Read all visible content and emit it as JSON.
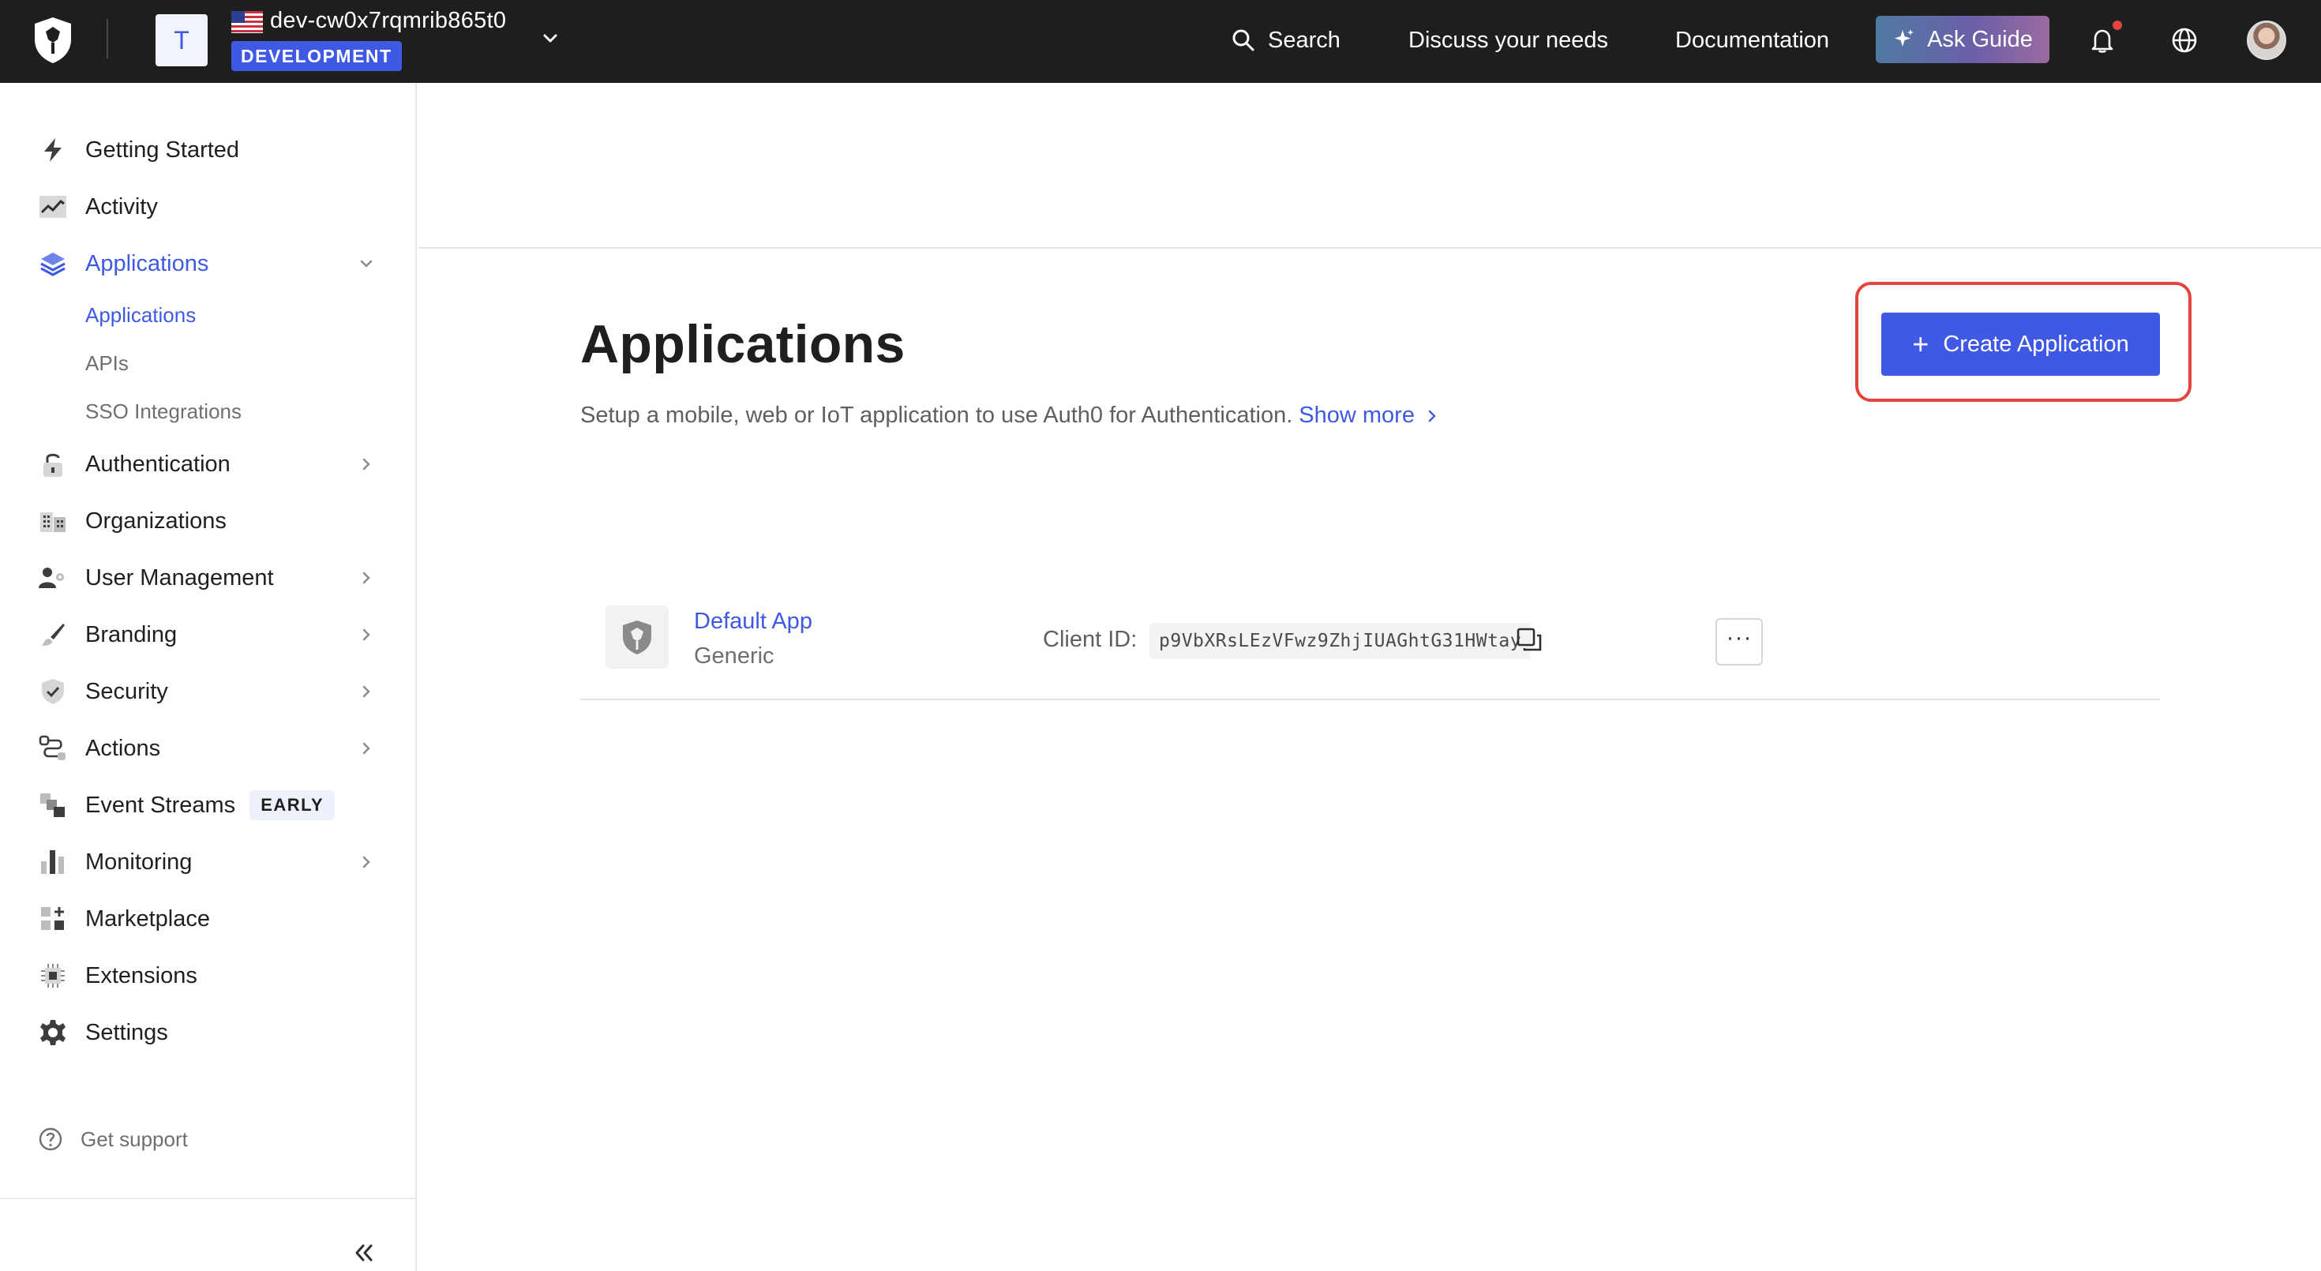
{
  "topbar": {
    "tenant_initial": "T",
    "tenant_name": "dev-cw0x7rqmrib865t0",
    "environment_badge": "DEVELOPMENT",
    "search_label": "Search",
    "discuss_label": "Discuss your needs",
    "documentation_label": "Documentation",
    "ask_guide_label": "Ask Guide",
    "icons": [
      "auth0-shield-logo",
      "us-flag-icon",
      "chevron-down-icon",
      "search-icon",
      "sparkle-icon",
      "bell-icon",
      "globe-icon",
      "user-avatar"
    ]
  },
  "sidebar": {
    "items": [
      {
        "label": "Getting Started",
        "icon": "lightning-icon"
      },
      {
        "label": "Activity",
        "icon": "activity-chart-icon"
      },
      {
        "label": "Applications",
        "icon": "layers-icon",
        "active": true,
        "expanded": true
      },
      {
        "label": "Authentication",
        "icon": "lock-icon"
      },
      {
        "label": "Organizations",
        "icon": "buildings-icon"
      },
      {
        "label": "User Management",
        "icon": "users-icon"
      },
      {
        "label": "Branding",
        "icon": "brush-icon"
      },
      {
        "label": "Security",
        "icon": "shield-check-icon"
      },
      {
        "label": "Actions",
        "icon": "flow-icon"
      },
      {
        "label": "Event Streams",
        "icon": "event-streams-icon",
        "badge": "EARLY"
      },
      {
        "label": "Monitoring",
        "icon": "bar-chart-icon"
      },
      {
        "label": "Marketplace",
        "icon": "marketplace-icon"
      },
      {
        "label": "Extensions",
        "icon": "chip-icon"
      },
      {
        "label": "Settings",
        "icon": "gear-icon"
      }
    ],
    "sub_items": [
      {
        "label": "Applications",
        "active": true
      },
      {
        "label": "APIs"
      },
      {
        "label": "SSO Integrations"
      }
    ],
    "support_label": "Get support"
  },
  "main": {
    "title": "Applications",
    "description": "Setup a mobile, web or IoT application to use Auth0 for Authentication.",
    "show_more_label": "Show more",
    "create_button_label": "Create Application",
    "applications": [
      {
        "name": "Default App",
        "type": "Generic",
        "client_id_label": "Client ID:",
        "client_id": "p9VbXRsLEzVFwz9ZhjIUAGhtG31HWtay"
      }
    ]
  },
  "colors": {
    "accent": "#3f59e4",
    "topbar_bg": "#1e1e1e",
    "highlight": "#e3443d"
  }
}
